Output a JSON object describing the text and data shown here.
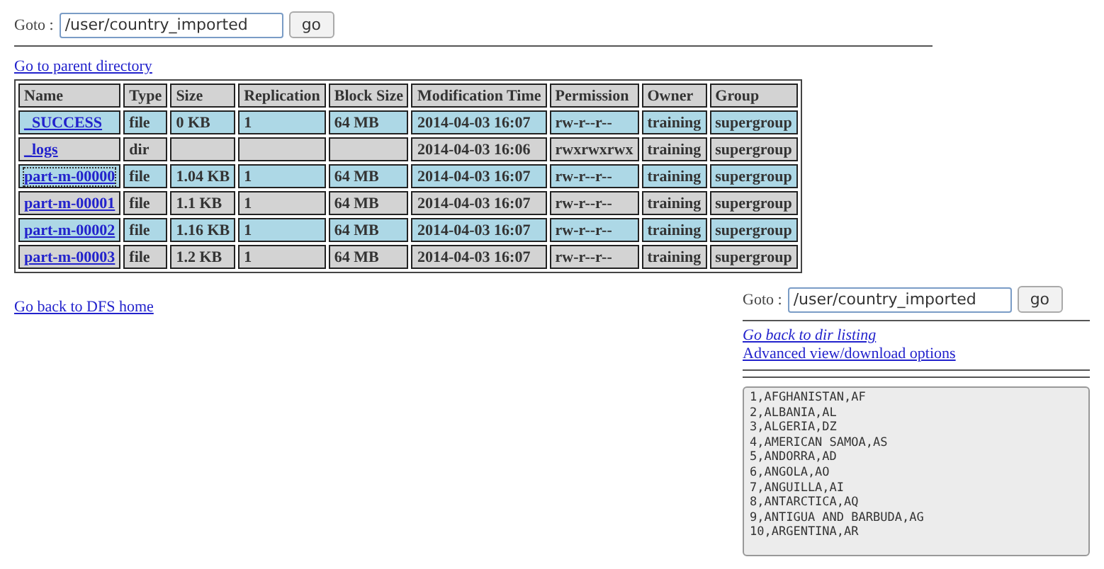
{
  "goto_top": {
    "label": "Goto :",
    "value": "/user/country_imported",
    "button": "go"
  },
  "parent_link": "Go to parent directory",
  "table": {
    "columns": [
      "Name",
      "Type",
      "Size",
      "Replication",
      "Block Size",
      "Modification Time",
      "Permission",
      "Owner",
      "Group"
    ],
    "rows": [
      {
        "focused": false,
        "cells": [
          "_SUCCESS",
          "file",
          "0 KB",
          "1",
          "64 MB",
          "2014-04-03 16:07",
          "rw-r--r--",
          "training",
          "supergroup"
        ]
      },
      {
        "focused": false,
        "cells": [
          "_logs",
          "dir",
          "",
          "",
          "",
          "2014-04-03 16:06",
          "rwxrwxrwx",
          "training",
          "supergroup"
        ]
      },
      {
        "focused": true,
        "cells": [
          "part-m-00000",
          "file",
          "1.04 KB",
          "1",
          "64 MB",
          "2014-04-03 16:07",
          "rw-r--r--",
          "training",
          "supergroup"
        ]
      },
      {
        "focused": false,
        "cells": [
          "part-m-00001",
          "file",
          "1.1 KB",
          "1",
          "64 MB",
          "2014-04-03 16:07",
          "rw-r--r--",
          "training",
          "supergroup"
        ]
      },
      {
        "focused": false,
        "cells": [
          "part-m-00002",
          "file",
          "1.16 KB",
          "1",
          "64 MB",
          "2014-04-03 16:07",
          "rw-r--r--",
          "training",
          "supergroup"
        ]
      },
      {
        "focused": false,
        "cells": [
          "part-m-00003",
          "file",
          "1.2 KB",
          "1",
          "64 MB",
          "2014-04-03 16:07",
          "rw-r--r--",
          "training",
          "supergroup"
        ]
      }
    ]
  },
  "dfs_home_link": "Go back to DFS home",
  "goto_bottom": {
    "label": "Goto :",
    "value": "/user/country_imported",
    "button": "go"
  },
  "dir_listing_link": "Go back to dir listing",
  "advanced_link": "Advanced view/download options",
  "file_content": [
    "1,AFGHANISTAN,AF",
    "2,ALBANIA,AL",
    "3,ALGERIA,DZ",
    "4,AMERICAN SAMOA,AS",
    "5,ANDORRA,AD",
    "6,ANGOLA,AO",
    "7,ANGUILLA,AI",
    "8,ANTARCTICA,AQ",
    "9,ANTIGUA AND BARBUDA,AG",
    "10,ARGENTINA,AR"
  ]
}
